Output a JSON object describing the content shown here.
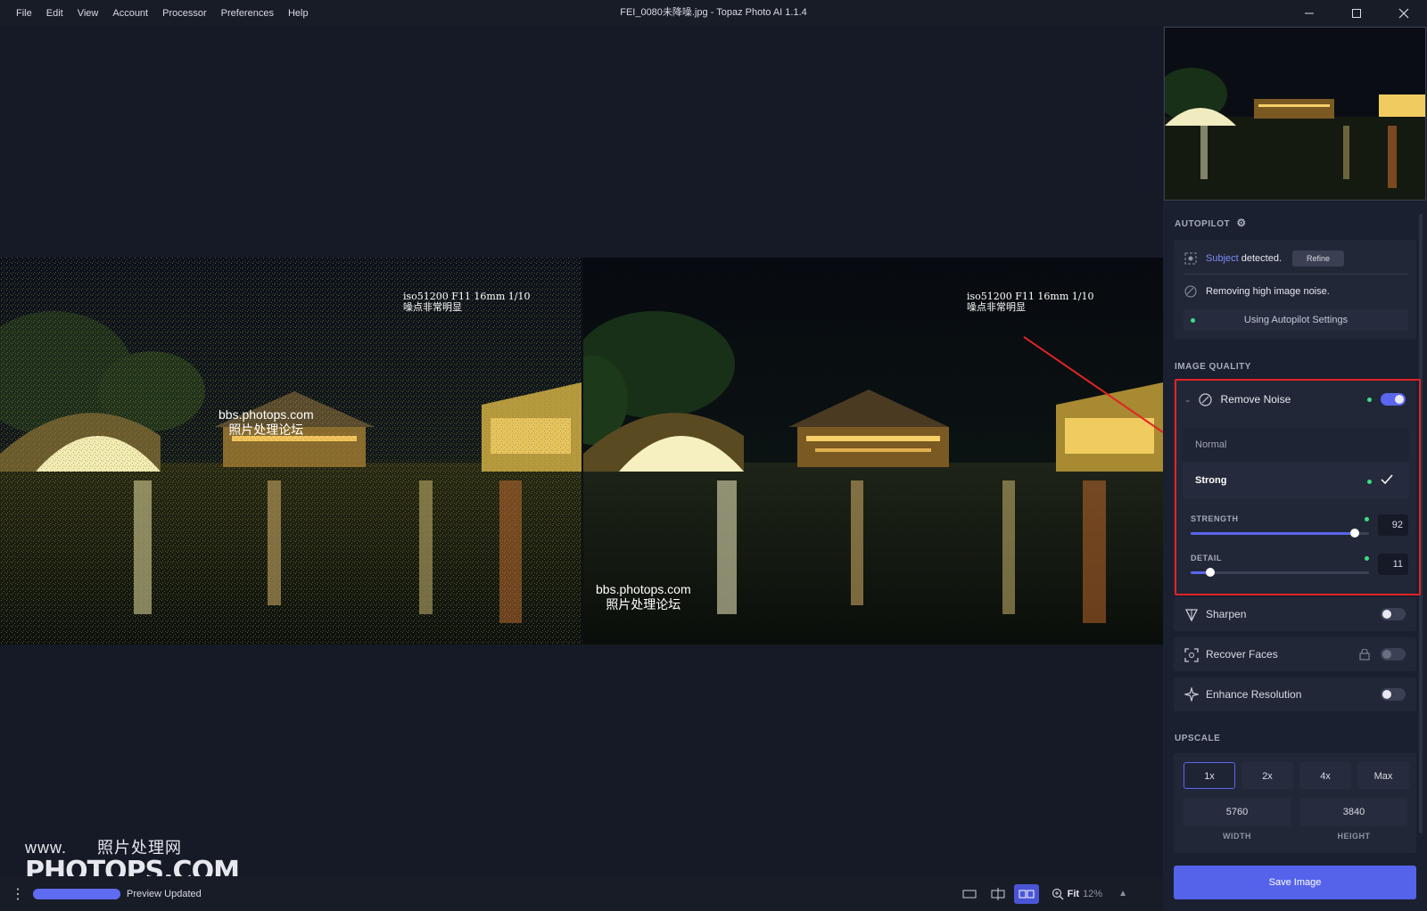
{
  "window": {
    "title": "FEI_0080未降噪.jpg - Topaz Photo AI 1.1.4",
    "menu": [
      "File",
      "Edit",
      "View",
      "Account",
      "Processor",
      "Preferences",
      "Help"
    ]
  },
  "photo": {
    "exif_line1": "iso51200 F11 16mm 1/10",
    "exif_line2": "噪点非常明显",
    "watermark_url": "bbs.photops.com",
    "watermark_cn": "照片处理论坛"
  },
  "site_watermark": {
    "line1_prefix": "www.",
    "line1_cn": "照片处理网",
    "line2": "PHOTOPS.COM"
  },
  "autopilot": {
    "label": "AUTOPILOT",
    "subject_word": "Subject",
    "subject_rest": " detected.",
    "refine": "Refine",
    "noise_msg": "Removing high image noise.",
    "settings_btn": "Using Autopilot Settings"
  },
  "image_quality": {
    "label": "IMAGE QUALITY",
    "remove_noise": {
      "name": "Remove Noise",
      "enabled": true,
      "modes": [
        "Normal",
        "Strong"
      ],
      "selected_mode": "Strong",
      "strength_label": "STRENGTH",
      "strength": "92",
      "detail_label": "DETAIL",
      "detail": "11"
    },
    "sharpen": {
      "name": "Sharpen",
      "enabled": false
    },
    "recover_faces": {
      "name": "Recover Faces",
      "enabled": false,
      "locked": true
    },
    "enhance_resolution": {
      "name": "Enhance Resolution",
      "enabled": false
    }
  },
  "upscale": {
    "label": "UPSCALE",
    "options": [
      "1x",
      "2x",
      "4x",
      "Max"
    ],
    "selected": "1x",
    "width": "5760",
    "height": "3840",
    "width_label": "WIDTH",
    "height_label": "HEIGHT"
  },
  "bottom": {
    "status": "Preview Updated",
    "progress": 1.0,
    "zoom_mode": "Fit",
    "zoom_pct": "12%"
  },
  "save": "Save Image",
  "colors": {
    "accent": "#5563eb",
    "highlight_frame": "#e02424",
    "active_dot": "#3ddc84"
  }
}
